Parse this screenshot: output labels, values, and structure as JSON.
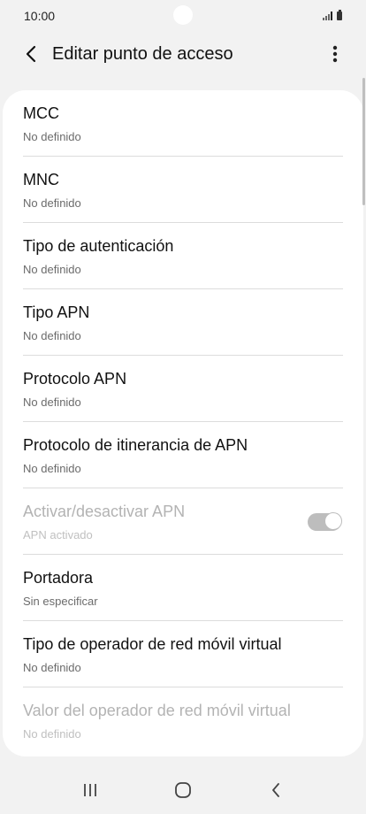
{
  "status_bar": {
    "time": "10:00"
  },
  "header": {
    "title": "Editar punto de acceso",
    "back_icon": "chevron-left-icon",
    "more_icon": "more-vertical-icon"
  },
  "settings": [
    {
      "title": "MCC",
      "subtitle": "No definido",
      "enabled": true
    },
    {
      "title": "MNC",
      "subtitle": "No definido",
      "enabled": true
    },
    {
      "title": "Tipo de autenticación",
      "subtitle": "No definido",
      "enabled": true
    },
    {
      "title": "Tipo APN",
      "subtitle": "No definido",
      "enabled": true
    },
    {
      "title": "Protocolo APN",
      "subtitle": "No definido",
      "enabled": true
    },
    {
      "title": "Protocolo de itinerancia de APN",
      "subtitle": "No definido",
      "enabled": true
    },
    {
      "title": "Activar/desactivar APN",
      "subtitle": "APN activado",
      "enabled": false,
      "toggle_on": true
    },
    {
      "title": "Portadora",
      "subtitle": "Sin especificar",
      "enabled": true
    },
    {
      "title": "Tipo de operador de red móvil virtual",
      "subtitle": "No definido",
      "enabled": true
    },
    {
      "title": "Valor del operador de red móvil virtual",
      "subtitle": "No definido",
      "enabled": false
    }
  ],
  "nav_bar": {
    "recents_icon": "recents-icon",
    "home_icon": "home-icon",
    "back_icon": "back-icon"
  },
  "colors": {
    "background": "#f2f2f2",
    "card": "#ffffff",
    "disabled_text": "#b3b3b3",
    "toggle": "#bdbdbd"
  }
}
